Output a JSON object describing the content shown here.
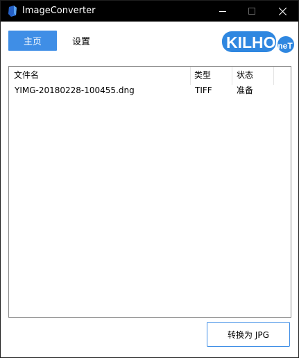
{
  "window": {
    "title": "ImageConverter"
  },
  "tabs": {
    "home_label": "主页",
    "settings_label": "设置"
  },
  "logo": {
    "main_text": "KILHO",
    "suffix_text": ".neT",
    "color": "#2f87e0"
  },
  "file_list": {
    "columns": [
      "文件名",
      "类型",
      "状态"
    ],
    "rows": [
      {
        "name": "YIMG-20180228-100455.dng",
        "type": "TIFF",
        "status": "准备"
      }
    ]
  },
  "actions": {
    "convert_label": "转换为 JPG"
  },
  "colors": {
    "accent": "#3f8ee6",
    "titlebar": "#000000"
  },
  "icons": {
    "app": "app-icon",
    "minimize": "minimize-icon",
    "maximize": "maximize-icon",
    "close": "close-icon"
  }
}
